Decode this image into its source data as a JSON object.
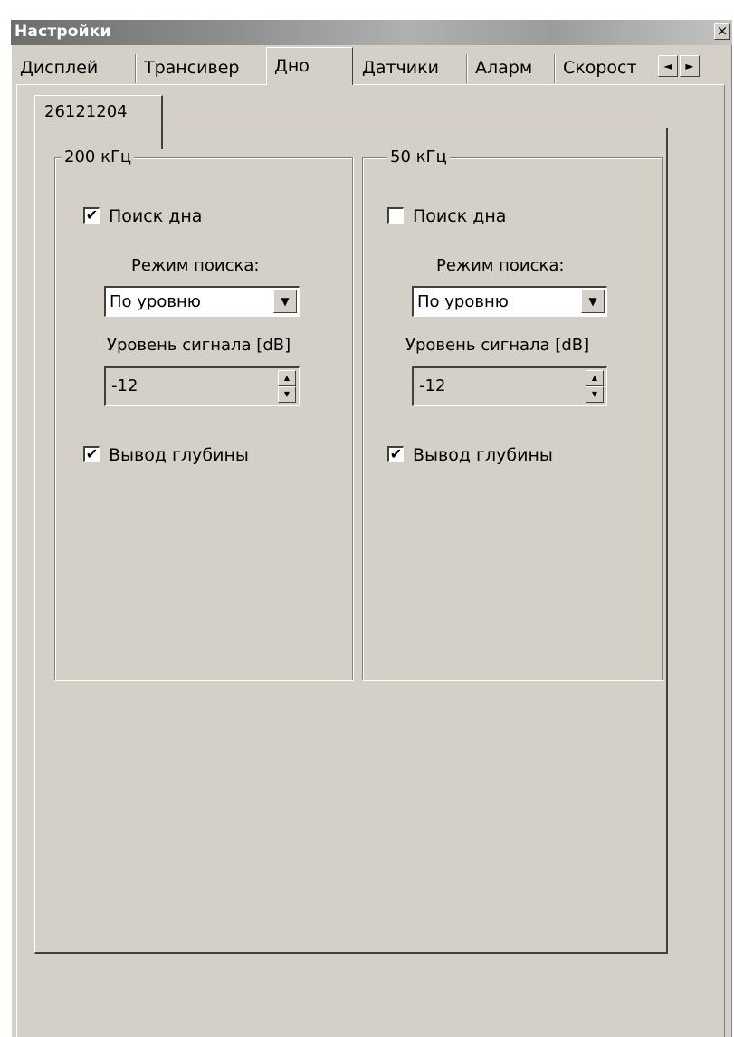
{
  "window": {
    "title": "Настройки",
    "close_glyph": "×"
  },
  "tabs": [
    {
      "label": "Дисплей"
    },
    {
      "label": "Трансивер"
    },
    {
      "label": "Дно"
    },
    {
      "label": "Датчики"
    },
    {
      "label": "Аларм"
    },
    {
      "label": "Скорост"
    }
  ],
  "active_tab": "Дно",
  "tab_scroll": {
    "left": "◄",
    "right": "►"
  },
  "device_tab": {
    "label": "26121204"
  },
  "groups": [
    {
      "title": "200 кГц",
      "bottom_search": {
        "label": "Поиск дна",
        "checked": true,
        "mark": "✔"
      },
      "search_mode_label": "Режим поиска:",
      "search_mode_value": "По уровню",
      "signal_level_label": "Уровень сигнала [dB]",
      "signal_level_value": "-12",
      "depth_output": {
        "label": "Вывод глубины",
        "checked": true,
        "mark": "✔"
      }
    },
    {
      "title": "50 кГц",
      "bottom_search": {
        "label": "Поиск дна",
        "checked": false,
        "mark": ""
      },
      "search_mode_label": "Режим поиска:",
      "search_mode_value": "По уровню",
      "signal_level_label": "Уровень сигнала [dB]",
      "signal_level_value": "-12",
      "depth_output": {
        "label": "Вывод глубины",
        "checked": true,
        "mark": "✔"
      }
    }
  ],
  "icons": {
    "dropdown": "▼",
    "spin_up": "▲",
    "spin_down": "▼"
  },
  "colors": {
    "face": "#d4d0c8",
    "title_text": "#ffffff"
  }
}
